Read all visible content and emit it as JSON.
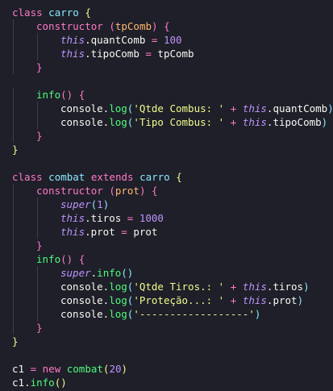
{
  "code": {
    "lines": [
      {
        "indent": 0,
        "tokens": [
          [
            "kw",
            "class"
          ],
          [
            "pun",
            " "
          ],
          [
            "cls",
            "carro"
          ],
          [
            "pun",
            " "
          ],
          [
            "br1",
            "{"
          ]
        ]
      },
      {
        "indent": 1,
        "tokens": [
          [
            "kw",
            "constructor"
          ],
          [
            "pun",
            " "
          ],
          [
            "br2",
            "("
          ],
          [
            "prm",
            "tpComb"
          ],
          [
            "br2",
            ")"
          ],
          [
            "pun",
            " "
          ],
          [
            "br2",
            "{"
          ]
        ]
      },
      {
        "indent": 2,
        "tokens": [
          [
            "ths",
            "this"
          ],
          [
            "pun",
            ".quantComb "
          ],
          [
            "op",
            "="
          ],
          [
            "pun",
            " "
          ],
          [
            "num",
            "100"
          ]
        ]
      },
      {
        "indent": 2,
        "tokens": [
          [
            "ths",
            "this"
          ],
          [
            "pun",
            ".tipoComb "
          ],
          [
            "op",
            "="
          ],
          [
            "pun",
            " tpComb"
          ]
        ]
      },
      {
        "indent": 1,
        "tokens": [
          [
            "br2",
            "}"
          ]
        ]
      },
      {
        "indent": 0,
        "tokens": []
      },
      {
        "indent": 1,
        "tokens": [
          [
            "fn",
            "info"
          ],
          [
            "br2",
            "()"
          ],
          [
            "pun",
            " "
          ],
          [
            "br2",
            "{"
          ]
        ]
      },
      {
        "indent": 2,
        "tokens": [
          [
            "pun",
            "console."
          ],
          [
            "fn",
            "log"
          ],
          [
            "br3",
            "("
          ],
          [
            "str",
            "'Qtde Combus: '"
          ],
          [
            "pun",
            " "
          ],
          [
            "op",
            "+"
          ],
          [
            "pun",
            " "
          ],
          [
            "ths",
            "this"
          ],
          [
            "pun",
            ".quantComb"
          ],
          [
            "br3",
            ")"
          ]
        ]
      },
      {
        "indent": 2,
        "tokens": [
          [
            "pun",
            "console."
          ],
          [
            "fn",
            "log"
          ],
          [
            "br3",
            "("
          ],
          [
            "str",
            "'Tipo Combus: '"
          ],
          [
            "pun",
            " "
          ],
          [
            "op",
            "+"
          ],
          [
            "pun",
            " "
          ],
          [
            "ths",
            "this"
          ],
          [
            "pun",
            ".tipoComb"
          ],
          [
            "br3",
            ")"
          ]
        ]
      },
      {
        "indent": 1,
        "tokens": [
          [
            "br2",
            "}"
          ]
        ]
      },
      {
        "indent": 0,
        "tokens": [
          [
            "br1",
            "}"
          ]
        ]
      },
      {
        "indent": 0,
        "tokens": []
      },
      {
        "indent": 0,
        "tokens": [
          [
            "kw",
            "class"
          ],
          [
            "pun",
            " "
          ],
          [
            "cls",
            "combat"
          ],
          [
            "pun",
            " "
          ],
          [
            "kw",
            "extends"
          ],
          [
            "pun",
            " "
          ],
          [
            "cls",
            "carro"
          ],
          [
            "pun",
            " "
          ],
          [
            "br1",
            "{"
          ]
        ]
      },
      {
        "indent": 1,
        "tokens": [
          [
            "kw",
            "constructor"
          ],
          [
            "pun",
            " "
          ],
          [
            "br2",
            "("
          ],
          [
            "prm",
            "prot"
          ],
          [
            "br2",
            ")"
          ],
          [
            "pun",
            " "
          ],
          [
            "br2",
            "{"
          ]
        ]
      },
      {
        "indent": 2,
        "tokens": [
          [
            "ths",
            "super"
          ],
          [
            "br3",
            "("
          ],
          [
            "num",
            "1"
          ],
          [
            "br3",
            ")"
          ]
        ]
      },
      {
        "indent": 2,
        "tokens": [
          [
            "ths",
            "this"
          ],
          [
            "pun",
            ".tiros "
          ],
          [
            "op",
            "="
          ],
          [
            "pun",
            " "
          ],
          [
            "num",
            "1000"
          ]
        ]
      },
      {
        "indent": 2,
        "tokens": [
          [
            "ths",
            "this"
          ],
          [
            "pun",
            ".prot "
          ],
          [
            "op",
            "="
          ],
          [
            "pun",
            " prot"
          ]
        ]
      },
      {
        "indent": 1,
        "tokens": [
          [
            "br2",
            "}"
          ]
        ]
      },
      {
        "indent": 1,
        "tokens": [
          [
            "fn",
            "info"
          ],
          [
            "br2",
            "()"
          ],
          [
            "pun",
            " "
          ],
          [
            "br2",
            "{"
          ]
        ]
      },
      {
        "indent": 2,
        "tokens": [
          [
            "ths",
            "super"
          ],
          [
            "pun",
            "."
          ],
          [
            "fn",
            "info"
          ],
          [
            "br3",
            "()"
          ]
        ]
      },
      {
        "indent": 2,
        "tokens": [
          [
            "pun",
            "console."
          ],
          [
            "fn",
            "log"
          ],
          [
            "br3",
            "("
          ],
          [
            "str",
            "'Qtde Tiros.: '"
          ],
          [
            "pun",
            " "
          ],
          [
            "op",
            "+"
          ],
          [
            "pun",
            " "
          ],
          [
            "ths",
            "this"
          ],
          [
            "pun",
            ".tiros"
          ],
          [
            "br3",
            ")"
          ]
        ]
      },
      {
        "indent": 2,
        "tokens": [
          [
            "pun",
            "console."
          ],
          [
            "fn",
            "log"
          ],
          [
            "br3",
            "("
          ],
          [
            "str",
            "'Proteção...: '"
          ],
          [
            "pun",
            " "
          ],
          [
            "op",
            "+"
          ],
          [
            "pun",
            " "
          ],
          [
            "ths",
            "this"
          ],
          [
            "pun",
            ".prot"
          ],
          [
            "br3",
            ")"
          ]
        ]
      },
      {
        "indent": 2,
        "tokens": [
          [
            "pun",
            "console."
          ],
          [
            "fn",
            "log"
          ],
          [
            "br3",
            "("
          ],
          [
            "str",
            "'------------------'"
          ],
          [
            "br3",
            ")"
          ]
        ]
      },
      {
        "indent": 1,
        "tokens": [
          [
            "br2",
            "}"
          ]
        ]
      },
      {
        "indent": 0,
        "tokens": [
          [
            "br1",
            "}"
          ]
        ]
      },
      {
        "indent": 0,
        "tokens": []
      },
      {
        "indent": 0,
        "tokens": [
          [
            "pun",
            "c1 "
          ],
          [
            "op",
            "="
          ],
          [
            "pun",
            " "
          ],
          [
            "kw",
            "new"
          ],
          [
            "pun",
            " "
          ],
          [
            "fn",
            "combat"
          ],
          [
            "br1",
            "("
          ],
          [
            "num",
            "20"
          ],
          [
            "br1",
            ")"
          ]
        ]
      },
      {
        "indent": 0,
        "tokens": [
          [
            "pun",
            "c1."
          ],
          [
            "fn",
            "info"
          ],
          [
            "br1",
            "()"
          ]
        ]
      }
    ]
  }
}
